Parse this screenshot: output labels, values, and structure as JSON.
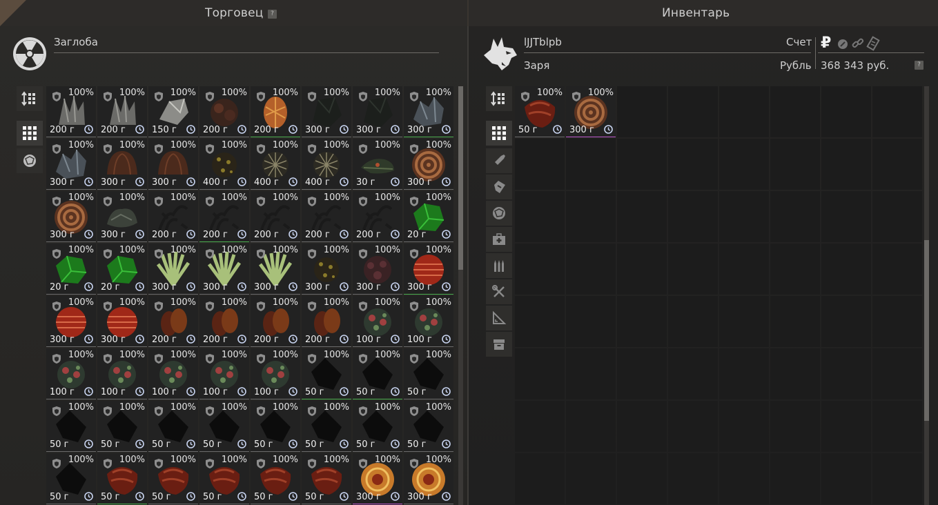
{
  "trader": {
    "title": "Торговец",
    "help": "?",
    "name": "Заглоба",
    "items": [
      {
        "pct": "100%",
        "price": "200 г",
        "art": "crystal-gray",
        "bar": "#6b6b6b"
      },
      {
        "pct": "100%",
        "price": "200 г",
        "art": "crystal-gray",
        "bar": "#6b6b6b"
      },
      {
        "pct": "100%",
        "price": "150 г",
        "art": "shard-white",
        "bar": "#6b6b6b"
      },
      {
        "pct": "100%",
        "price": "200 г",
        "art": "clump-brown",
        "bar": "#6b6b6b"
      },
      {
        "pct": "100%",
        "price": "200 г",
        "art": "egg-orange",
        "bar": "#4caf50"
      },
      {
        "pct": "100%",
        "price": "300 г",
        "art": "rock-dark",
        "bar": "#6b6b6b"
      },
      {
        "pct": "100%",
        "price": "300 г",
        "art": "rock-dark",
        "bar": "#6b6b6b"
      },
      {
        "pct": "100%",
        "price": "300 г",
        "art": "crystal-blue",
        "bar": "#4caf50"
      },
      {
        "pct": "100%",
        "price": "300 г",
        "art": "crystal-blue",
        "bar": "#6b6b6b"
      },
      {
        "pct": "100%",
        "price": "300 г",
        "art": "shell-brown",
        "bar": "#6b6b6b"
      },
      {
        "pct": "100%",
        "price": "300 г",
        "art": "shell-brown",
        "bar": "#6b6b6b"
      },
      {
        "pct": "100%",
        "price": "400 г",
        "art": "spore-yellow",
        "bar": "#6b6b6b"
      },
      {
        "pct": "100%",
        "price": "400 г",
        "art": "mesh-tan",
        "bar": "#6b6b6b"
      },
      {
        "pct": "100%",
        "price": "400 г",
        "art": "mesh-tan",
        "bar": "#6b6b6b"
      },
      {
        "pct": "100%",
        "price": "30 г",
        "art": "leaf-green",
        "bar": "#6b6b6b"
      },
      {
        "pct": "100%",
        "price": "300 г",
        "art": "spiral-brown",
        "bar": "#6b6b6b"
      },
      {
        "pct": "100%",
        "price": "300 г",
        "art": "spiral-brown",
        "bar": "#6b6b6b"
      },
      {
        "pct": "100%",
        "price": "300 г",
        "art": "moss-gray",
        "bar": "#6b6b6b"
      },
      {
        "pct": "100%",
        "price": "200 г",
        "art": "thorn-dark",
        "bar": "#6b6b6b"
      },
      {
        "pct": "100%",
        "price": "200 г",
        "art": "thorn-dark",
        "bar": "#4caf50"
      },
      {
        "pct": "100%",
        "price": "200 г",
        "art": "thorn-dark",
        "bar": "#6b6b6b"
      },
      {
        "pct": "100%",
        "price": "200 г",
        "art": "thorn-dark",
        "bar": "#6b6b6b"
      },
      {
        "pct": "100%",
        "price": "200 г",
        "art": "thorn-dark",
        "bar": "#6b6b6b"
      },
      {
        "pct": "100%",
        "price": "20 г",
        "art": "gem-green",
        "bar": "#6b6b6b"
      },
      {
        "pct": "100%",
        "price": "20 г",
        "art": "gem-green",
        "bar": "#6b6b6b"
      },
      {
        "pct": "100%",
        "price": "20 г",
        "art": "gem-green",
        "bar": "#6b6b6b"
      },
      {
        "pct": "100%",
        "price": "300 г",
        "art": "plant-lime",
        "bar": "#6b6b6b"
      },
      {
        "pct": "100%",
        "price": "300 г",
        "art": "plant-lime",
        "bar": "#6b6b6b"
      },
      {
        "pct": "100%",
        "price": "300 г",
        "art": "plant-lime",
        "bar": "#6b6b6b"
      },
      {
        "pct": "100%",
        "price": "300 г",
        "art": "spore-yellow",
        "bar": "#6b6b6b"
      },
      {
        "pct": "100%",
        "price": "300 г",
        "art": "clump-maroon",
        "bar": "#6b6b6b"
      },
      {
        "pct": "100%",
        "price": "300 г",
        "art": "ball-red",
        "bar": "#4caf50"
      },
      {
        "pct": "100%",
        "price": "300 г",
        "art": "ball-red",
        "bar": "#6b6b6b"
      },
      {
        "pct": "100%",
        "price": "300 г",
        "art": "ball-red",
        "bar": "#6b6b6b"
      },
      {
        "pct": "100%",
        "price": "200 г",
        "art": "pod-amber",
        "bar": "#6b6b6b"
      },
      {
        "pct": "100%",
        "price": "200 г",
        "art": "pod-amber",
        "bar": "#6b6b6b"
      },
      {
        "pct": "100%",
        "price": "200 г",
        "art": "pod-amber",
        "bar": "#6b6b6b"
      },
      {
        "pct": "100%",
        "price": "200 г",
        "art": "pod-amber",
        "bar": "#6b6b6b"
      },
      {
        "pct": "100%",
        "price": "100 г",
        "art": "coral-mix",
        "bar": "#6b6b6b"
      },
      {
        "pct": "100%",
        "price": "100 г",
        "art": "coral-mix",
        "bar": "#6b6b6b"
      },
      {
        "pct": "100%",
        "price": "100 г",
        "art": "coral-mix",
        "bar": "#6b6b6b"
      },
      {
        "pct": "100%",
        "price": "100 г",
        "art": "coral-mix",
        "bar": "#6b6b6b"
      },
      {
        "pct": "100%",
        "price": "100 г",
        "art": "coral-mix",
        "bar": "#6b6b6b"
      },
      {
        "pct": "100%",
        "price": "100 г",
        "art": "coral-mix",
        "bar": "#6b6b6b"
      },
      {
        "pct": "100%",
        "price": "100 г",
        "art": "coral-mix",
        "bar": "#6b6b6b"
      },
      {
        "pct": "100%",
        "price": "50 г",
        "art": "stone-black",
        "bar": "#4caf50"
      },
      {
        "pct": "100%",
        "price": "50 г",
        "art": "stone-black",
        "bar": "#4caf50"
      },
      {
        "pct": "100%",
        "price": "50 г",
        "art": "stone-black",
        "bar": "#6b6b6b"
      },
      {
        "pct": "100%",
        "price": "50 г",
        "art": "stone-black",
        "bar": "#6b6b6b"
      },
      {
        "pct": "100%",
        "price": "50 г",
        "art": "stone-black",
        "bar": "#6b6b6b"
      },
      {
        "pct": "100%",
        "price": "50 г",
        "art": "stone-black",
        "bar": "#6b6b6b"
      },
      {
        "pct": "100%",
        "price": "50 г",
        "art": "stone-black",
        "bar": "#6b6b6b"
      },
      {
        "pct": "100%",
        "price": "50 г",
        "art": "stone-black",
        "bar": "#6b6b6b"
      },
      {
        "pct": "100%",
        "price": "50 г",
        "art": "stone-black",
        "bar": "#6b6b6b"
      },
      {
        "pct": "100%",
        "price": "50 г",
        "art": "stone-black",
        "bar": "#6b6b6b"
      },
      {
        "pct": "100%",
        "price": "50 г",
        "art": "stone-black",
        "bar": "#6b6b6b"
      },
      {
        "pct": "100%",
        "price": "50 г",
        "art": "stone-black",
        "bar": "#6b6b6b"
      },
      {
        "pct": "100%",
        "price": "50 г",
        "art": "meat-red",
        "bar": "#4caf50"
      },
      {
        "pct": "100%",
        "price": "50 г",
        "art": "meat-red",
        "bar": "#6b6b6b"
      },
      {
        "pct": "100%",
        "price": "50 г",
        "art": "meat-red",
        "bar": "#6b6b6b"
      },
      {
        "pct": "100%",
        "price": "50 г",
        "art": "meat-red",
        "bar": "#6b6b6b"
      },
      {
        "pct": "100%",
        "price": "50 г",
        "art": "meat-red",
        "bar": "#6b6b6b"
      },
      {
        "pct": "100%",
        "price": "300 г",
        "art": "swirl-orange",
        "bar": "#c05ad0"
      },
      {
        "pct": "100%",
        "price": "300 г",
        "art": "swirl-orange",
        "bar": "#6b6b6b"
      }
    ]
  },
  "inventory": {
    "title": "Инвентарь",
    "player_name": "lJJTblpb",
    "faction": "Заря",
    "account_label": "Счет",
    "currency_label": "Рубль",
    "currency_symbol": "₽",
    "balance": "368 343 руб.",
    "help": "?",
    "items": [
      {
        "pct": "100%",
        "price": "50 г",
        "art": "meat-red",
        "bar": "#6b6b6b"
      },
      {
        "pct": "100%",
        "price": "300 г",
        "art": "spiral-brown",
        "bar": "#c05ad0"
      }
    ]
  },
  "colors": {
    "panel_bg": "#262523",
    "cell_bg": "#222222",
    "accent_green": "#4caf50",
    "accent_purple": "#c05ad0"
  }
}
